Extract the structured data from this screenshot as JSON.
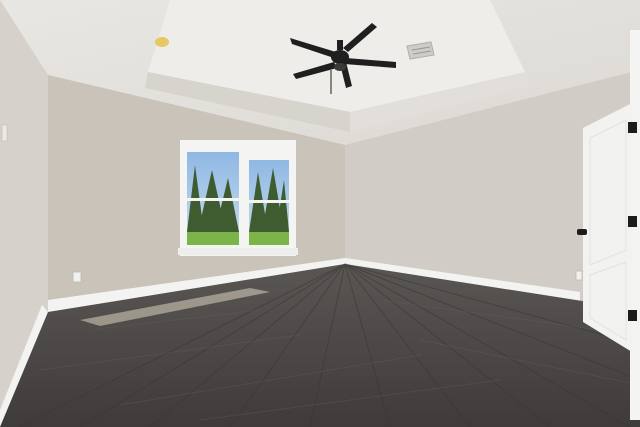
{
  "scene": {
    "subject": "empty bedroom",
    "colors": {
      "wall_left": "#d8d4ce",
      "wall_back": "#cbc6bd",
      "wall_right": "#d3cfc8",
      "ceiling": "#e6e4e0",
      "tray": "#ecebe8",
      "floor": "#4d4a48",
      "baseboard": "#f4f4f2",
      "door": "#f2f2f0",
      "fan": "#1f1f1f",
      "sky": "#9fc3e6",
      "grass": "#7bb54a",
      "trees": "#3d5b2f"
    },
    "icons": [
      "ceiling-fan-icon",
      "ceiling-light-icon",
      "air-vent-icon",
      "door-hinge-icon",
      "door-knob-icon",
      "outlet-icon"
    ]
  },
  "watermark": {
    "present": true
  }
}
